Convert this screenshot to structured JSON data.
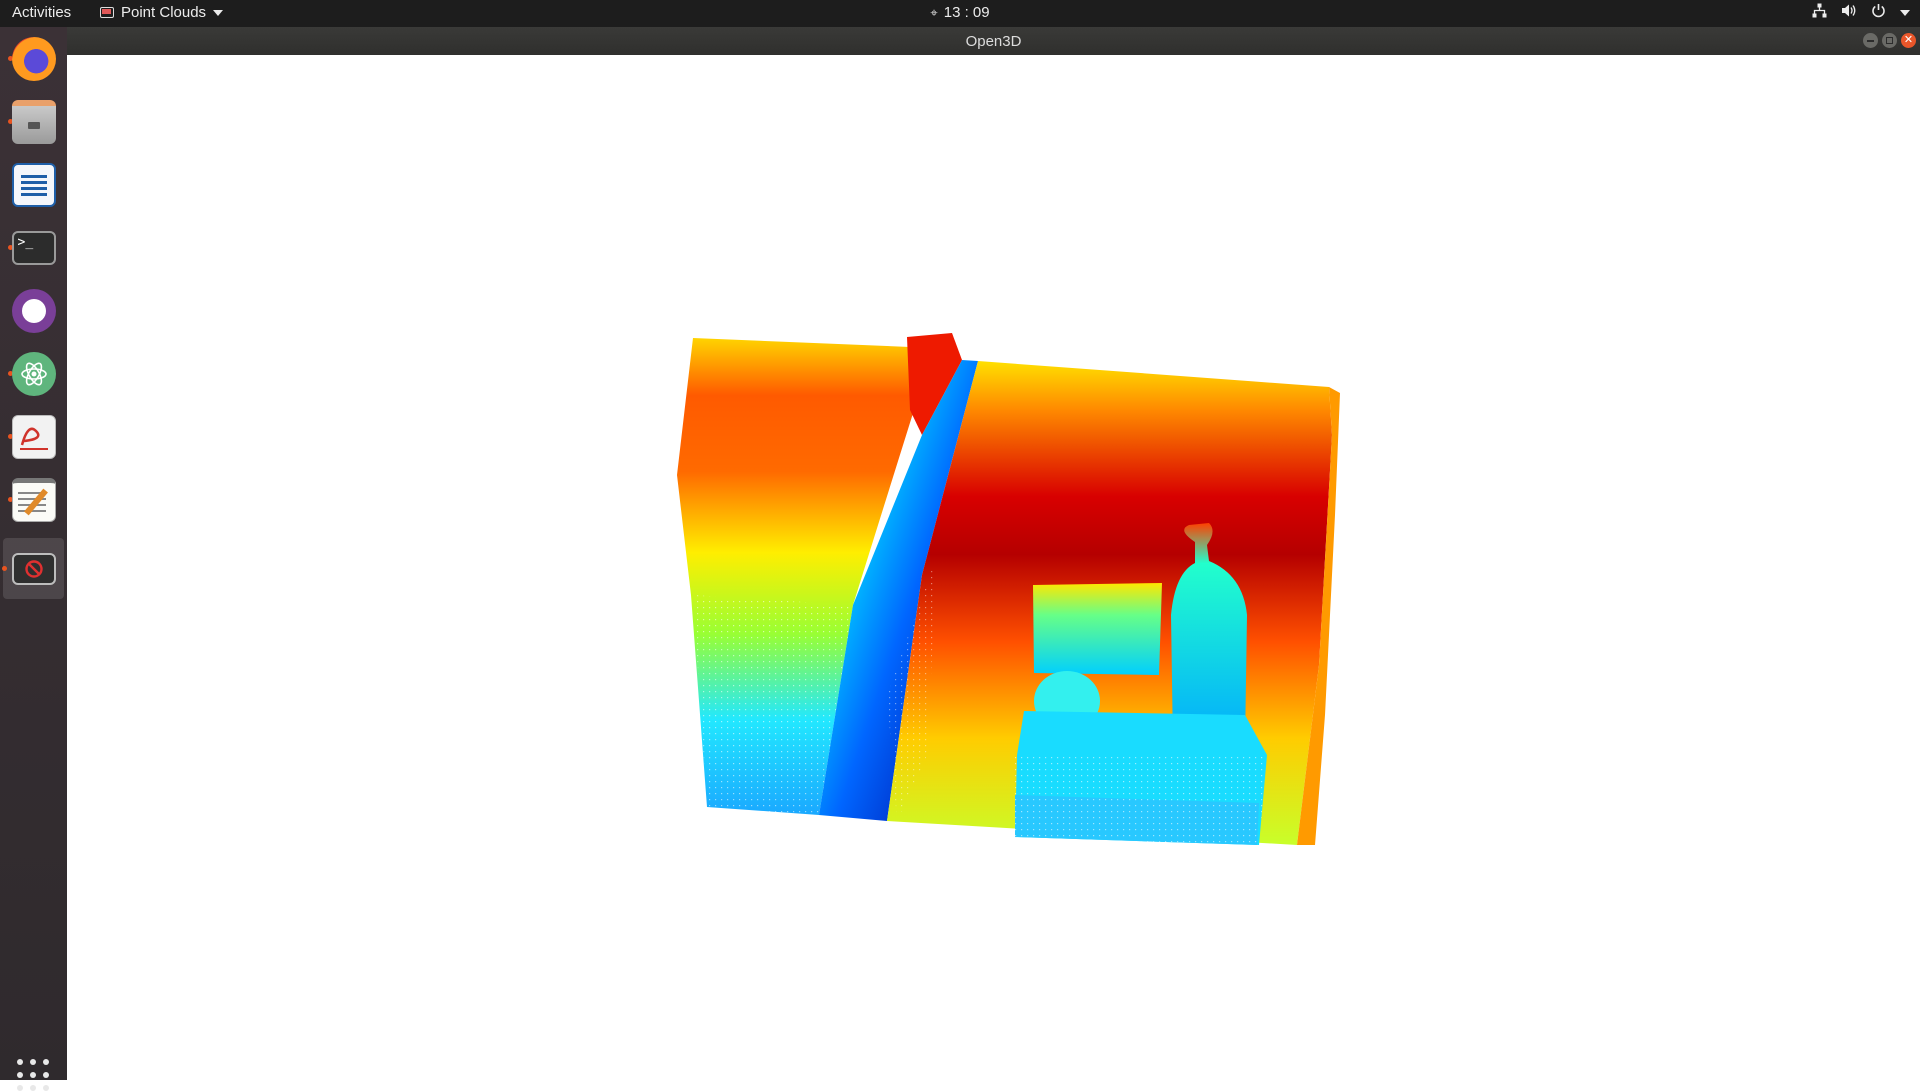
{
  "topbar": {
    "activities": "Activities",
    "app_menu": "Point Clouds",
    "clock": "13 : 09",
    "clock_icon": "alarm-icon",
    "tray_icons": [
      "network-icon",
      "volume-icon",
      "power-icon",
      "chevron-down-icon"
    ]
  },
  "window": {
    "title": "Open3D",
    "controls": [
      "minimize",
      "maximize",
      "close"
    ]
  },
  "dock": {
    "items": [
      {
        "name": "firefox",
        "running": true
      },
      {
        "name": "files",
        "running": true
      },
      {
        "name": "libreoffice-writer",
        "running": false
      },
      {
        "name": "terminal",
        "running": true
      },
      {
        "name": "github-desktop",
        "running": false
      },
      {
        "name": "atom",
        "running": true
      },
      {
        "name": "document-viewer",
        "running": true
      },
      {
        "name": "text-editor",
        "running": true
      },
      {
        "name": "open3d",
        "running": true,
        "active": true
      }
    ],
    "show_apps": "show-applications-icon"
  },
  "colors": {
    "accent": "#e95420",
    "topbar_bg": "#1d1d1d",
    "titlebar_bg": "#33332f",
    "dock_bg": "#352d31",
    "canvas_bg": "#ffffff",
    "colormap": [
      "#00008b",
      "#0000ff",
      "#00b4ff",
      "#00ffff",
      "#7fff00",
      "#ffff00",
      "#ff9900",
      "#ff3300",
      "#b40000"
    ]
  }
}
